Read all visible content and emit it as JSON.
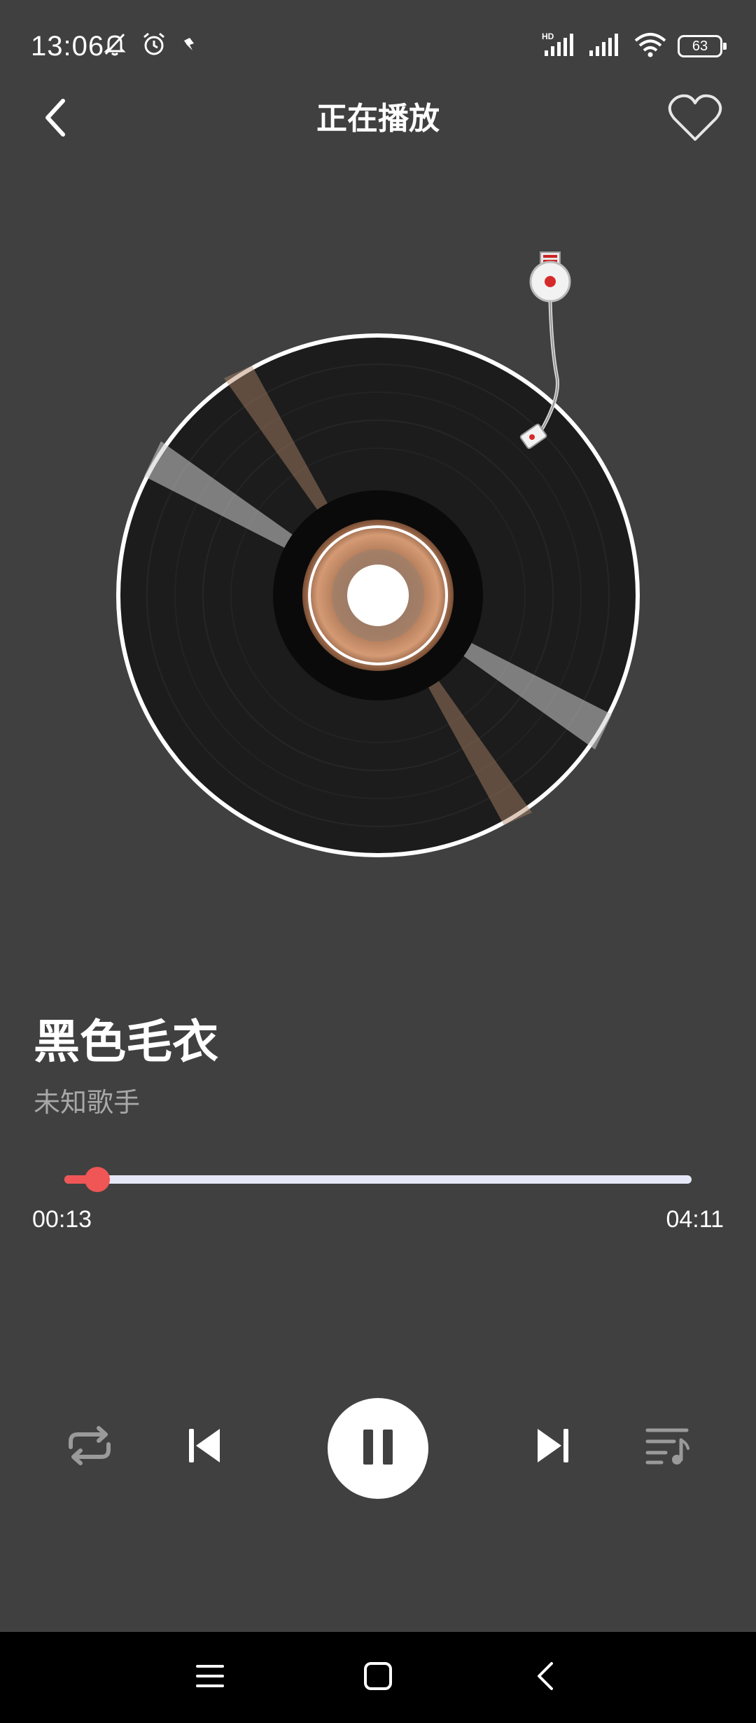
{
  "status_bar": {
    "time": "13:06",
    "battery_level": "63",
    "icons": [
      "bell-off-icon",
      "alarm-icon",
      "app-notification-icon",
      "hd-signal-icon",
      "signal-icon",
      "wifi-icon",
      "battery-icon"
    ]
  },
  "header": {
    "title": "正在播放",
    "back_icon": "chevron-left-icon",
    "favorite_icon": "heart-outline-icon"
  },
  "song": {
    "title": "黑色毛衣",
    "artist": "未知歌手"
  },
  "progress": {
    "current_time": "00:13",
    "total_time": "04:11",
    "fraction": 0.052
  },
  "controls": {
    "repeat_icon": "repeat-icon",
    "previous_icon": "skip-previous-icon",
    "play_pause_icon": "pause-icon",
    "next_icon": "skip-next-icon",
    "playlist_icon": "playlist-icon"
  },
  "nav_bar": {
    "icons": [
      "menu-icon",
      "home-square-icon",
      "back-icon"
    ]
  },
  "colors": {
    "background": "#404040",
    "accent": "#f05656",
    "track": "#e6e8f8",
    "secondary_text": "#a8a8a8"
  }
}
